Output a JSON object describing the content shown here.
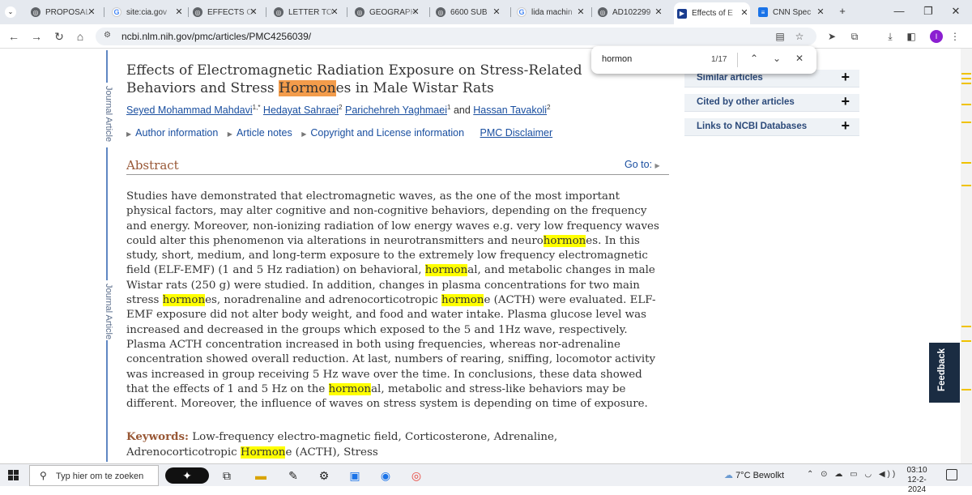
{
  "browser": {
    "tabs": [
      {
        "title": "PROPOSAL",
        "icon": "globe-icon"
      },
      {
        "title": "site:cia.gov",
        "icon": "google-icon"
      },
      {
        "title": "EFFECTS OF",
        "icon": "globe-icon"
      },
      {
        "title": "LETTER TO",
        "icon": "globe-icon"
      },
      {
        "title": "GEOGRAPHY",
        "icon": "globe-icon"
      },
      {
        "title": "6600 SUB",
        "icon": "globe-icon"
      },
      {
        "title": "lida machin",
        "icon": "google-icon"
      },
      {
        "title": "AD102299",
        "icon": "globe-icon"
      },
      {
        "title": "Effects of E",
        "icon": "pmc-icon",
        "active": true
      },
      {
        "title": "CNN Spec",
        "icon": "cnn-icon"
      }
    ],
    "url": "ncbi.nlm.nih.gov/pmc/articles/PMC4256039/",
    "avatar_letter": "I"
  },
  "find": {
    "query": "hormon",
    "count": "1/17"
  },
  "sidebar_label": "Journal Article",
  "article": {
    "title_before": "Effects of Electromagnetic Radiation Exposure on Stress-Related Behaviors and Stress ",
    "title_match": "Hormon",
    "title_after": "es in Male Wistar Rats",
    "authors": [
      {
        "name": "Seyed Mohammad Mahdavi",
        "sup": "1,*"
      },
      {
        "name": "Hedayat Sahraei",
        "sup": "2"
      },
      {
        "name": "Parichehreh Yaghmaei",
        "sup": "1"
      },
      {
        "name": "Hassan Tavakoli",
        "sup": "2"
      }
    ],
    "and": "and",
    "info_links": [
      "Author information",
      "Article notes",
      "Copyright and License information"
    ],
    "disclaimer": "PMC Disclaimer",
    "abstract_heading": "Abstract",
    "goto": "Go to:",
    "abstract_parts": [
      "Studies have demonstrated that electromagnetic waves, as the one of the most important physical factors, may alter cognitive and non-cognitive behaviors, depending on the frequency and energy. Moreover, non-ionizing radiation of low energy waves e.g. very low frequency waves could alter this phenomenon via alterations in neurotransmitters and neuro",
      "hormon",
      "es. In this study, short, medium, and long-term exposure to the extremely low frequency electromagnetic field (ELF-EMF) (1 and 5 Hz radiation) on behavioral, ",
      "hormon",
      "al, and metabolic changes in male Wistar rats (250 g) were studied. In addition, changes in plasma concentrations for two main stress ",
      "hormon",
      "es, noradrenaline and adrenocorticotropic ",
      "hormon",
      "e (ACTH) were evaluated. ELF-EMF exposure did not alter body weight, and food and water intake. Plasma glucose level was increased and decreased in the groups which exposed to the 5 and 1Hz wave, respectively. Plasma ACTH concentration increased in both using frequencies, whereas nor-adrenaline concentration showed overall reduction. At last, numbers of rearing, sniffing, locomotor activity was increased in group receiving 5 Hz wave over the time. In conclusions, these data showed that the effects of 1 and 5 Hz on the ",
      "hormon",
      "al, metabolic and stress-like behaviors may be different. Moreover, the influence of waves on stress system is depending on time of exposure."
    ],
    "keywords_label": "Keywords:",
    "keywords_text": " Low-frequency electro-magnetic field, Corticosterone, Adrenaline, Adrenocorticotropic ",
    "keywords_match": "Hormon",
    "keywords_after": "e (ACTH), Stress"
  },
  "right_panel": [
    {
      "label": "Similar articles"
    },
    {
      "label": "Cited by other articles"
    },
    {
      "label": "Links to NCBI Databases"
    }
  ],
  "feedback": "Feedback",
  "taskbar": {
    "search_placeholder": "Typ hier om te zoeken",
    "weather": "7°C  Bewolkt",
    "time": "03:10",
    "date": "12-2-2024"
  },
  "colors": {
    "active_match": "#f39c4b",
    "match": "#ffff00",
    "link": "#1a4fa0",
    "heading": "#985735"
  }
}
